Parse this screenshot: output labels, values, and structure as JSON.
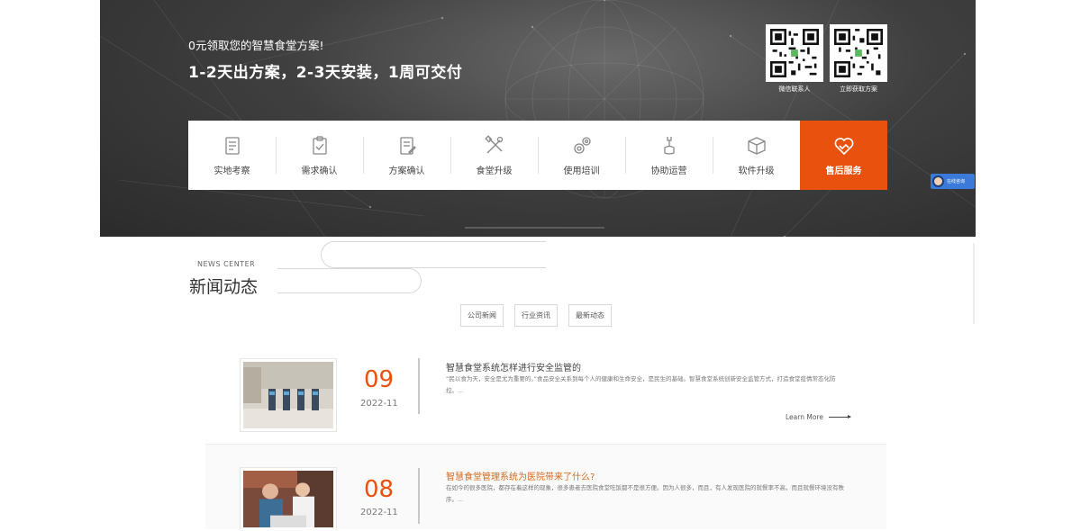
{
  "hero": {
    "subtitle": "0元领取您的智慧食堂方案!",
    "title": "1-2天出方案，2-3天安装，1周可交付",
    "qr": [
      {
        "caption": "微信联系人",
        "icon": "qr-code"
      },
      {
        "caption": "立即获取方案",
        "icon": "qr-code"
      }
    ],
    "steps": [
      {
        "label": "实地考察",
        "icon": "clipboard-list-icon"
      },
      {
        "label": "需求确认",
        "icon": "clipboard-check-icon"
      },
      {
        "label": "方案确认",
        "icon": "document-edit-icon"
      },
      {
        "label": "食堂升级",
        "icon": "tools-icon"
      },
      {
        "label": "使用培训",
        "icon": "gears-icon"
      },
      {
        "label": "协助运营",
        "icon": "wrench-hand-icon"
      },
      {
        "label": "软件升级",
        "icon": "box-icon"
      },
      {
        "label": "售后服务",
        "icon": "handshake-heart-icon",
        "active": true
      }
    ],
    "chat": {
      "text": "在线咨询"
    }
  },
  "news": {
    "en_title": "NEWS CENTER",
    "zh_title": "新闻动态",
    "tabs": [
      "公司新闻",
      "行业资讯",
      "最新动态"
    ],
    "items": [
      {
        "day": "09",
        "yearmonth": "2022-11",
        "title": "智慧食堂系统怎样进行安全监管的",
        "desc": "“民以食为天，安全是尤为重要的。”食品安全关系到每个人的健康和生命安全，是民生的基础。智慧食堂系统创新安全监管方式，打造食堂疫情常态化防控。...",
        "more": "Learn More"
      },
      {
        "day": "08",
        "yearmonth": "2022-11",
        "title": "智慧食堂管理系统为医院带来了什么?",
        "desc": "在如今的很多医院，都存在着这样的现象，很多患者去医院食堂吃饭都不是很方便。因为人很多，而且，有人发现医院的就餐率不高，而且就餐环境没有秩序。..."
      }
    ]
  },
  "colors": {
    "accent": "#e8520e",
    "hero_bg": "#3f3f3f"
  }
}
